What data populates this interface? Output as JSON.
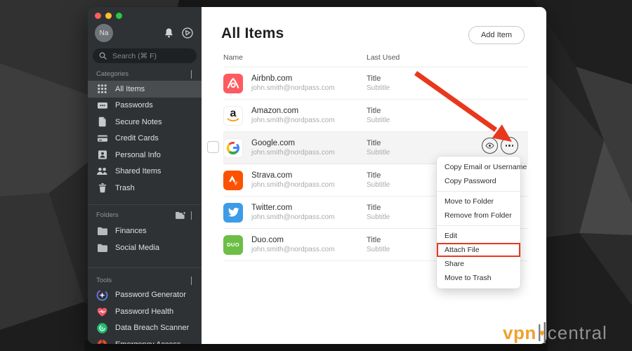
{
  "window": {
    "traffic_lights": [
      "close",
      "minimize",
      "zoom"
    ],
    "sidebar": {
      "avatar_initials": "Na",
      "search": {
        "placeholder": "Search (⌘ F)"
      },
      "sections": [
        {
          "label": "Categories",
          "items": [
            {
              "icon": "grid-icon",
              "label": "All Items",
              "selected": true
            },
            {
              "icon": "passwords-icon",
              "label": "Passwords"
            },
            {
              "icon": "secure-notes-icon",
              "label": "Secure Notes"
            },
            {
              "icon": "credit-cards-icon",
              "label": "Credit Cards"
            },
            {
              "icon": "personal-info-icon",
              "label": "Personal Info"
            },
            {
              "icon": "shared-items-icon",
              "label": "Shared Items"
            },
            {
              "icon": "trash-icon",
              "label": "Trash"
            }
          ]
        },
        {
          "label": "Folders",
          "header_icon": "folder-plus-icon",
          "items": [
            {
              "icon": "folder-icon",
              "label": "Finances"
            },
            {
              "icon": "folder-icon",
              "label": "Social Media"
            }
          ]
        },
        {
          "label": "Tools",
          "items": [
            {
              "icon": "generator-icon",
              "label": "Password Generator"
            },
            {
              "icon": "health-icon",
              "label": "Password Health"
            },
            {
              "icon": "breach-icon",
              "label": "Data Breach Scanner"
            },
            {
              "icon": "emergency-icon",
              "label": "Emergency Access"
            }
          ]
        }
      ]
    },
    "main": {
      "title": "All Items",
      "add_button": "Add Item",
      "columns": [
        "Name",
        "Last Used"
      ],
      "rows": [
        {
          "icon": "airbnb-icon",
          "name": "Airbnb.com",
          "username": "john.smith@nordpass.com",
          "title": "Title",
          "subtitle": "Subtitle"
        },
        {
          "icon": "amazon-icon",
          "name": "Amazon.com",
          "username": "john.smith@nordpass.com",
          "title": "Title",
          "subtitle": "Subtitle"
        },
        {
          "icon": "google-icon",
          "name": "Google.com",
          "username": "john.smith@nordpass.com",
          "title": "Title",
          "subtitle": "Subtitle",
          "selected": true,
          "checkbox": true,
          "actions": true
        },
        {
          "icon": "strava-icon",
          "name": "Strava.com",
          "username": "john.smith@nordpass.com",
          "title": "Title",
          "subtitle": "Subtitle"
        },
        {
          "icon": "twitter-icon",
          "name": "Twitter.com",
          "username": "john.smith@nordpass.com",
          "title": "Title",
          "subtitle": "Subtitle"
        },
        {
          "icon": "duo-icon",
          "name": "Duo.com",
          "username": "john.smith@nordpass.com",
          "title": "Title",
          "subtitle": "Subtitle"
        }
      ]
    },
    "context_menu": {
      "groups": [
        [
          "Copy Email or Username",
          "Copy Password"
        ],
        [
          "Move to Folder",
          "Remove from Folder"
        ],
        [
          "Edit",
          "Attach File",
          "Share",
          "Move to Trash"
        ]
      ],
      "highlighted_item": "Attach File"
    }
  },
  "annotations": {
    "arrow": "red-arrow-pointing-to-more-options"
  },
  "watermark": {
    "brand": "vpn",
    "suffix": "central"
  },
  "colors": {
    "accent_red": "#e8381c",
    "sidebar_bg": "#2f3234",
    "selected_sidebar_item": "#494d4f",
    "selected_row": "#f4f4f5",
    "watermark_orange": "#f0a02e"
  }
}
